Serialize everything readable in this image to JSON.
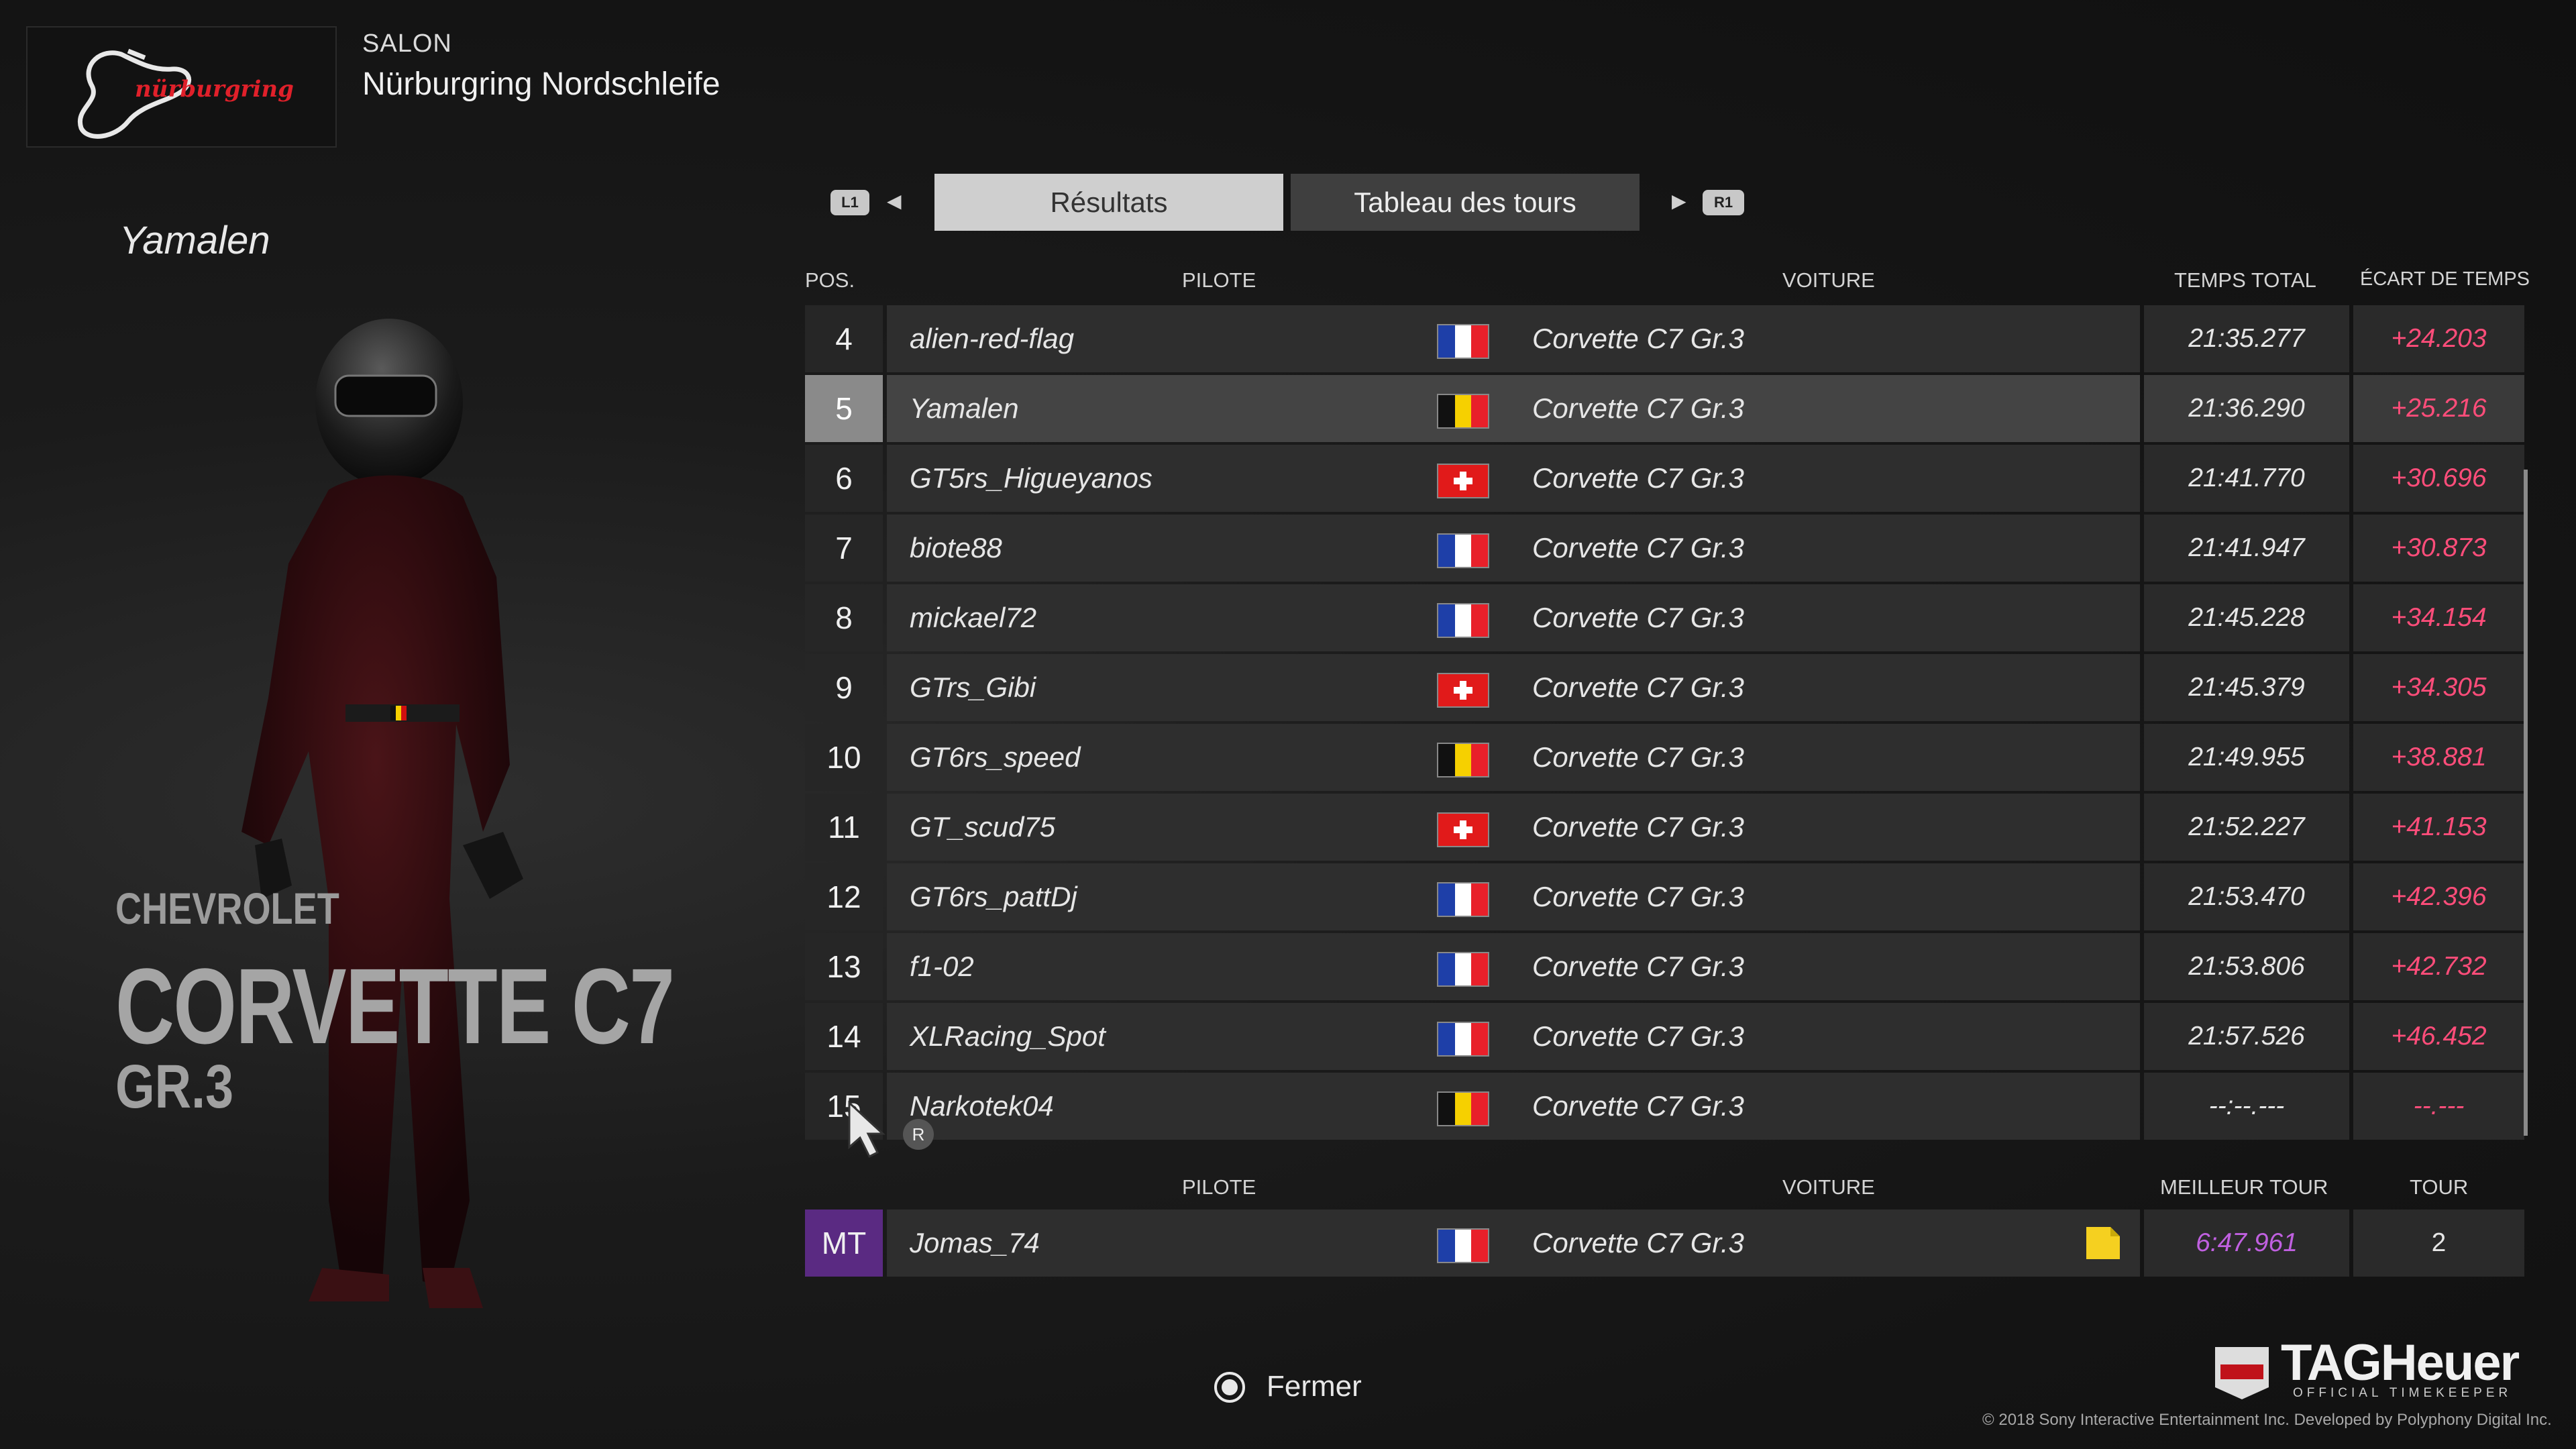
{
  "header": {
    "category": "SALON",
    "track": "Nürburgring Nordschleife",
    "logo_text": "nürburgring"
  },
  "driver": {
    "name": "Yamalen"
  },
  "car": {
    "make": "CHEVROLET",
    "model": "CORVETTE C7",
    "class": "GR.3"
  },
  "tabs": {
    "left_button": "L1",
    "right_button": "R1",
    "results": "Résultats",
    "laps": "Tableau des tours"
  },
  "table_headers": {
    "pos": "POS.",
    "pilot": "PILOTE",
    "car": "VOITURE",
    "total_time": "TEMPS TOTAL",
    "gap": "ÉCART DE TEMPS"
  },
  "rows": [
    {
      "pos": "4",
      "pilot": "alien-red-flag",
      "flag": "fr",
      "car": "Corvette C7 Gr.3",
      "time": "21:35.277",
      "gap": "+24.203"
    },
    {
      "pos": "5",
      "pilot": "Yamalen",
      "flag": "be",
      "car": "Corvette C7 Gr.3",
      "time": "21:36.290",
      "gap": "+25.216"
    },
    {
      "pos": "6",
      "pilot": "GT5rs_Higueyanos",
      "flag": "ch",
      "car": "Corvette C7 Gr.3",
      "time": "21:41.770",
      "gap": "+30.696"
    },
    {
      "pos": "7",
      "pilot": "biote88",
      "flag": "fr",
      "car": "Corvette C7 Gr.3",
      "time": "21:41.947",
      "gap": "+30.873"
    },
    {
      "pos": "8",
      "pilot": "mickael72",
      "flag": "fr",
      "car": "Corvette C7 Gr.3",
      "time": "21:45.228",
      "gap": "+34.154"
    },
    {
      "pos": "9",
      "pilot": "GTrs_Gibi",
      "flag": "ch",
      "car": "Corvette C7 Gr.3",
      "time": "21:45.379",
      "gap": "+34.305"
    },
    {
      "pos": "10",
      "pilot": "GT6rs_speed",
      "flag": "be",
      "car": "Corvette C7 Gr.3",
      "time": "21:49.955",
      "gap": "+38.881"
    },
    {
      "pos": "11",
      "pilot": "GT_scud75",
      "flag": "ch",
      "car": "Corvette C7 Gr.3",
      "time": "21:52.227",
      "gap": "+41.153"
    },
    {
      "pos": "12",
      "pilot": "GT6rs_pattDj",
      "flag": "fr",
      "car": "Corvette C7 Gr.3",
      "time": "21:53.470",
      "gap": "+42.396"
    },
    {
      "pos": "13",
      "pilot": "f1-02",
      "flag": "fr",
      "car": "Corvette C7 Gr.3",
      "time": "21:53.806",
      "gap": "+42.732"
    },
    {
      "pos": "14",
      "pilot": "XLRacing_Spot",
      "flag": "fr",
      "car": "Corvette C7 Gr.3",
      "time": "21:57.526",
      "gap": "+46.452"
    },
    {
      "pos": "15",
      "pilot": "Narkotek04",
      "flag": "be",
      "car": "Corvette C7 Gr.3",
      "time": "--:--.---",
      "gap": "--.---"
    }
  ],
  "cursor_badge": "R",
  "best_lap_headers": {
    "pilot": "PILOTE",
    "car": "VOITURE",
    "best_lap": "MEILLEUR TOUR",
    "lap": "TOUR"
  },
  "best_lap": {
    "badge": "MT",
    "pilot": "Jomas_74",
    "flag": "fr",
    "car": "Corvette C7 Gr.3",
    "time": "6:47.961",
    "lap": "2"
  },
  "footer": {
    "close": "Fermer",
    "brand": "TAGHeuer",
    "brand_sub": "OFFICIAL TIMEKEEPER",
    "brand_badge": "TAG HEUER",
    "copyright": "© 2018 Sony Interactive Entertainment Inc. Developed by Polyphony Digital Inc."
  },
  "colors": {
    "gap_red": "#ff4d7a",
    "best_lap_purple": "#c060e0",
    "mt_badge": "#5a2a82",
    "nurburgring_red": "#e0202a"
  },
  "icons": [
    "nurburgring-logo-icon",
    "driver-figure",
    "mouse-cursor-icon",
    "circle-button-icon",
    "tag-heuer-logo-icon",
    "flag-icon",
    "note-icon"
  ]
}
